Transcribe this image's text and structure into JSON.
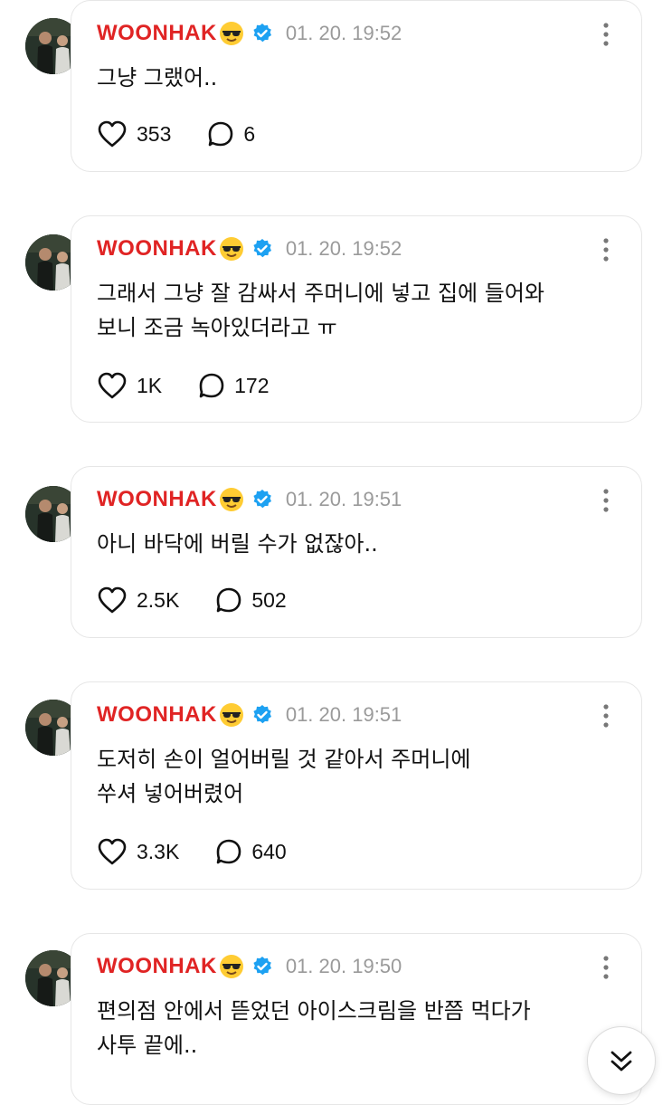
{
  "posts": [
    {
      "username": "WOONHAK",
      "emoji": "sunglasses-emoji",
      "verified": true,
      "timestamp": "01. 20. 19:52",
      "text": "그냥 그랬어..",
      "likes": "353",
      "comments": "6"
    },
    {
      "username": "WOONHAK",
      "emoji": "sunglasses-emoji",
      "verified": true,
      "timestamp": "01. 20. 19:52",
      "text": "그래서 그냥 잘 감싸서 주머니에 넣고 집에 들어와\n보니 조금 녹아있더라고 ㅠ",
      "likes": "1K",
      "comments": "172"
    },
    {
      "username": "WOONHAK",
      "emoji": "sunglasses-emoji",
      "verified": true,
      "timestamp": "01. 20. 19:51",
      "text": "아니 바닥에 버릴 수가 없잖아..",
      "likes": "2.5K",
      "comments": "502"
    },
    {
      "username": "WOONHAK",
      "emoji": "sunglasses-emoji",
      "verified": true,
      "timestamp": "01. 20. 19:51",
      "text": "도저히 손이 얼어버릴 것 같아서 주머니에\n쑤셔 넣어버렸어",
      "likes": "3.3K",
      "comments": "640"
    },
    {
      "username": "WOONHAK",
      "emoji": "sunglasses-emoji",
      "verified": true,
      "timestamp": "01. 20. 19:50",
      "text": "편의점 안에서 뜯었던 아이스크림을 반쯤 먹다가\n사투 끝에..",
      "likes": "",
      "comments": ""
    }
  ],
  "icons": {
    "like": "heart-icon",
    "comment": "speech-bubble-icon",
    "more": "vertical-dots-icon",
    "verified": "verified-badge-icon",
    "scroll": "double-chevron-down-icon"
  },
  "colors": {
    "username": "#e02424",
    "timestamp": "#9a9a9a",
    "verified": "#1da1f2",
    "border": "#e6e6e6"
  }
}
